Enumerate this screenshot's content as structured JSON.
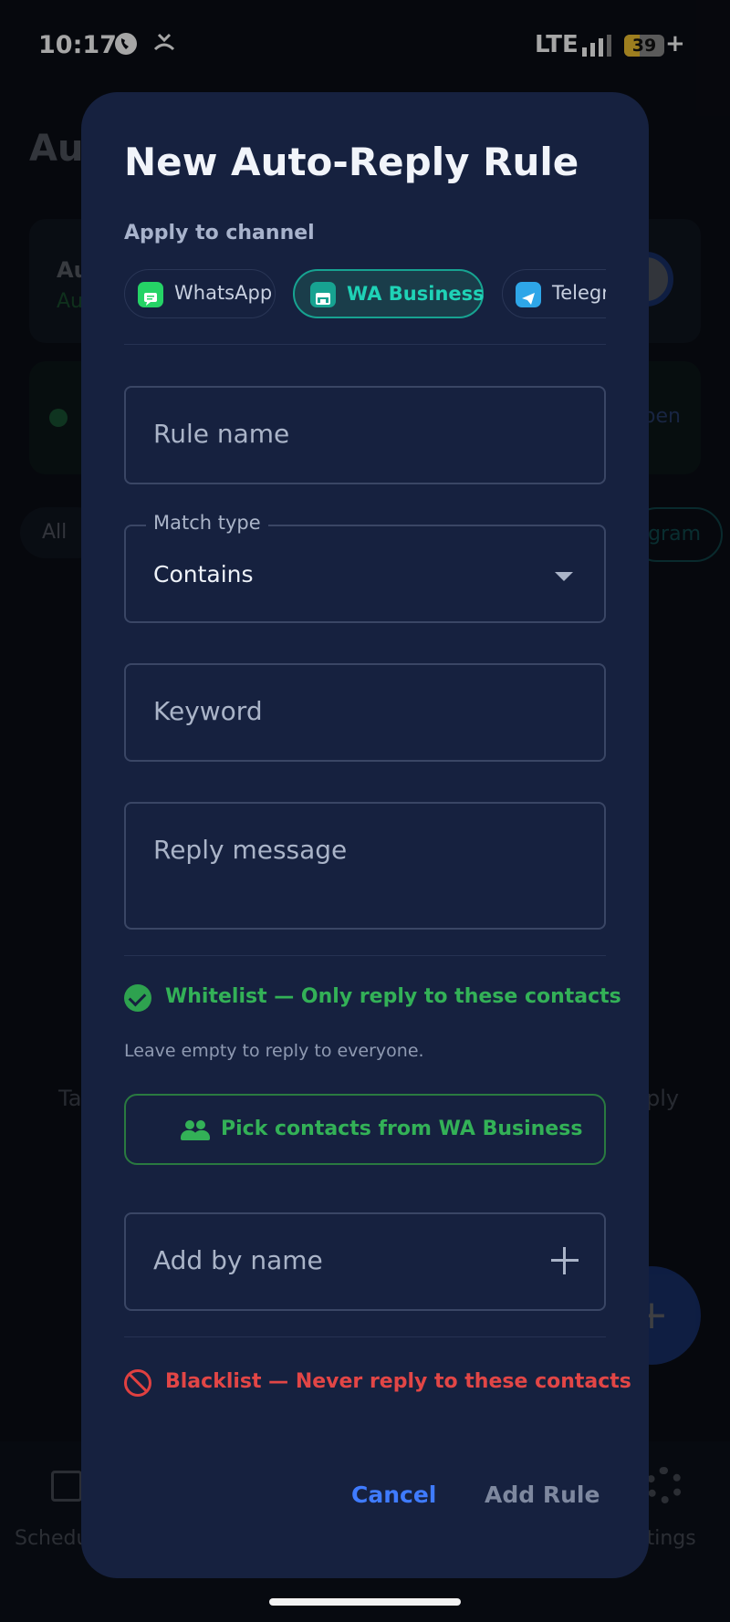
{
  "status_bar": {
    "time": "10:17",
    "network": "LTE",
    "battery_level": "39",
    "battery_fraction": 0.39,
    "charging_symbol": "+"
  },
  "background": {
    "title": "Au",
    "card_title": "Au",
    "card_subtitle": "Au",
    "open_link": "pen",
    "filter_all": "All",
    "filter_telegram": "gram",
    "empty_left": "Ta",
    "empty_right": "ply",
    "fab_symbol": "+",
    "nav_left": "Schedu",
    "nav_right": "ttings"
  },
  "dialog": {
    "title": "New Auto-Reply Rule",
    "channel_section_label": "Apply to channel",
    "channels": [
      {
        "label": "WhatsApp",
        "icon": "whatsapp-icon",
        "selected": false
      },
      {
        "label": "WA Business",
        "icon": "wa-business-icon",
        "selected": true
      },
      {
        "label": "Telegram",
        "icon": "telegram-icon",
        "selected": false
      }
    ],
    "rule_name": {
      "placeholder": "Rule name",
      "value": ""
    },
    "match_type": {
      "label": "Match type",
      "value": "Contains"
    },
    "keyword": {
      "placeholder": "Keyword",
      "value": ""
    },
    "reply_message": {
      "placeholder": "Reply message",
      "value": ""
    },
    "whitelist": {
      "title": "Whitelist — Only reply to these contacts",
      "hint": "Leave empty to reply to everyone.",
      "pick_button": "Pick contacts from WA Business",
      "add_by_name_placeholder": "Add by name"
    },
    "blacklist": {
      "title": "Blacklist — Never reply to these contacts"
    },
    "actions": {
      "cancel": "Cancel",
      "add_rule": "Add Rule"
    }
  },
  "colors": {
    "dialog_bg": "#16213f",
    "accent_blue": "#3f7bff",
    "accent_teal": "#17a391",
    "whitelist_green": "#33b157",
    "blacklist_red": "#e24646"
  }
}
